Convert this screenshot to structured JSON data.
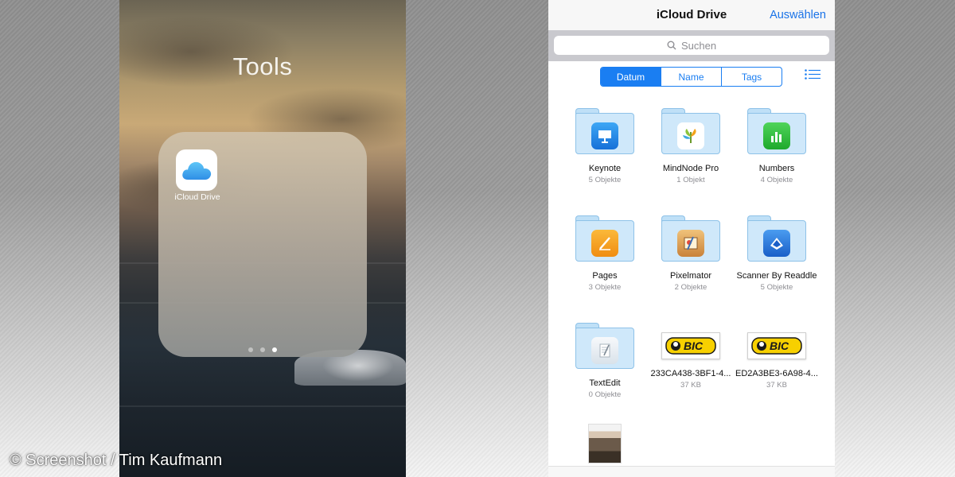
{
  "left_screen": {
    "folder_title": "Tools",
    "app": {
      "label": "iCloud Drive",
      "icon": "icloud-icon"
    },
    "page_dots": 3,
    "active_dot": 3,
    "credit": "© Screenshot / Tim Kaufmann"
  },
  "icloud": {
    "title": "iCloud Drive",
    "action": "Auswählen",
    "search_placeholder": "Suchen",
    "tabs": [
      "Datum",
      "Name",
      "Tags"
    ],
    "active_tab": "Datum",
    "items": [
      {
        "name": "Keynote",
        "meta": "5 Objekte",
        "type": "folder",
        "icon": "keynote-icon",
        "color": "#1d8cf0"
      },
      {
        "name": "MindNode Pro",
        "meta": "1 Objekt",
        "type": "folder",
        "icon": "mindnode-icon",
        "color": "#ffffff"
      },
      {
        "name": "Numbers",
        "meta": "4 Objekte",
        "type": "folder",
        "icon": "numbers-icon",
        "color": "#2ec13a"
      },
      {
        "name": "Pages",
        "meta": "3 Objekte",
        "type": "folder",
        "icon": "pages-icon",
        "color": "#f7a21b"
      },
      {
        "name": "Pixelmator",
        "meta": "2 Objekte",
        "type": "folder",
        "icon": "pixelmator-icon",
        "color": "#e8a24c"
      },
      {
        "name": "Scanner By Readdle",
        "meta": "5 Objekte",
        "type": "folder",
        "icon": "scanner-icon",
        "color": "#1f6fd6"
      },
      {
        "name": "TextEdit",
        "meta": "0 Objekte",
        "type": "folder",
        "icon": "textedit-icon",
        "color": "#e9eef3"
      },
      {
        "name": "233CA438-3BF1-4...",
        "meta": "37 KB",
        "type": "image",
        "icon": "bic-logo-icon",
        "color": "#f7d000"
      },
      {
        "name": "ED2A3BE3-6A98-4...",
        "meta": "37 KB",
        "type": "image",
        "icon": "bic-logo-icon",
        "color": "#f7d000"
      }
    ],
    "colors": {
      "accent": "#1a7ef2",
      "folder": "#cfe8fa"
    }
  }
}
